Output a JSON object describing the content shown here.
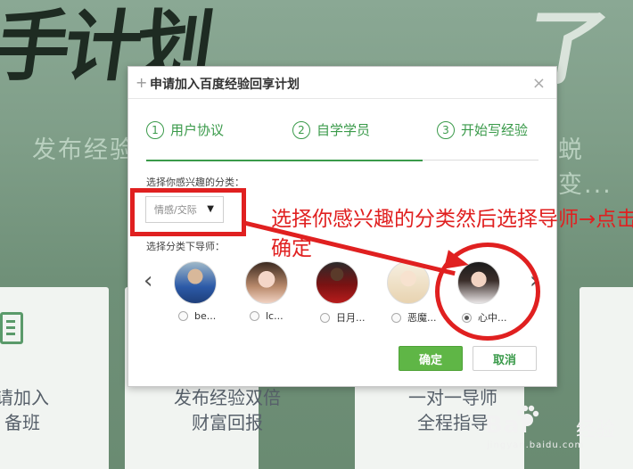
{
  "background": {
    "brush_left": "手计划",
    "brush_right": "了",
    "slogan_left": "发布经验",
    "slogan_right": "蜕变...",
    "cards": [
      {
        "text_line1": "请加入",
        "text_line2": "备班"
      },
      {
        "text_line1": "发布经验双倍",
        "text_line2": "财富回报"
      },
      {
        "text_line1": "一对一导师",
        "text_line2": "全程指导"
      }
    ]
  },
  "dialog": {
    "title": "申请加入百度经验回享计划",
    "close": "×",
    "steps": [
      {
        "num": "1",
        "label": "用户协议"
      },
      {
        "num": "2",
        "label": "自学学员"
      },
      {
        "num": "3",
        "label": "开始写经验"
      }
    ],
    "category_label": "选择你感兴趣的分类：",
    "category_value": "情感/交际",
    "tutor_label": "选择分类下导师：",
    "tutors": [
      {
        "name": "be...",
        "selected": false
      },
      {
        "name": "lc...",
        "selected": false
      },
      {
        "name": "日月...",
        "selected": false
      },
      {
        "name": "恶魔...",
        "selected": false
      },
      {
        "name": "心中...",
        "selected": true
      }
    ],
    "prev": "‹",
    "next": "›",
    "ok_label": "确定",
    "cancel_label": "取消"
  },
  "annotation": {
    "text": "选择你感兴趣的分类然后选择导师→点击确定",
    "color": "#e02020"
  },
  "watermark": {
    "brand": "Bai",
    "brand2": "经验",
    "url": "jingyan.baidu.com"
  },
  "colors": {
    "accent_green": "#3a9a4a",
    "ok_button": "#5fb646",
    "annotation_red": "#e02020"
  }
}
